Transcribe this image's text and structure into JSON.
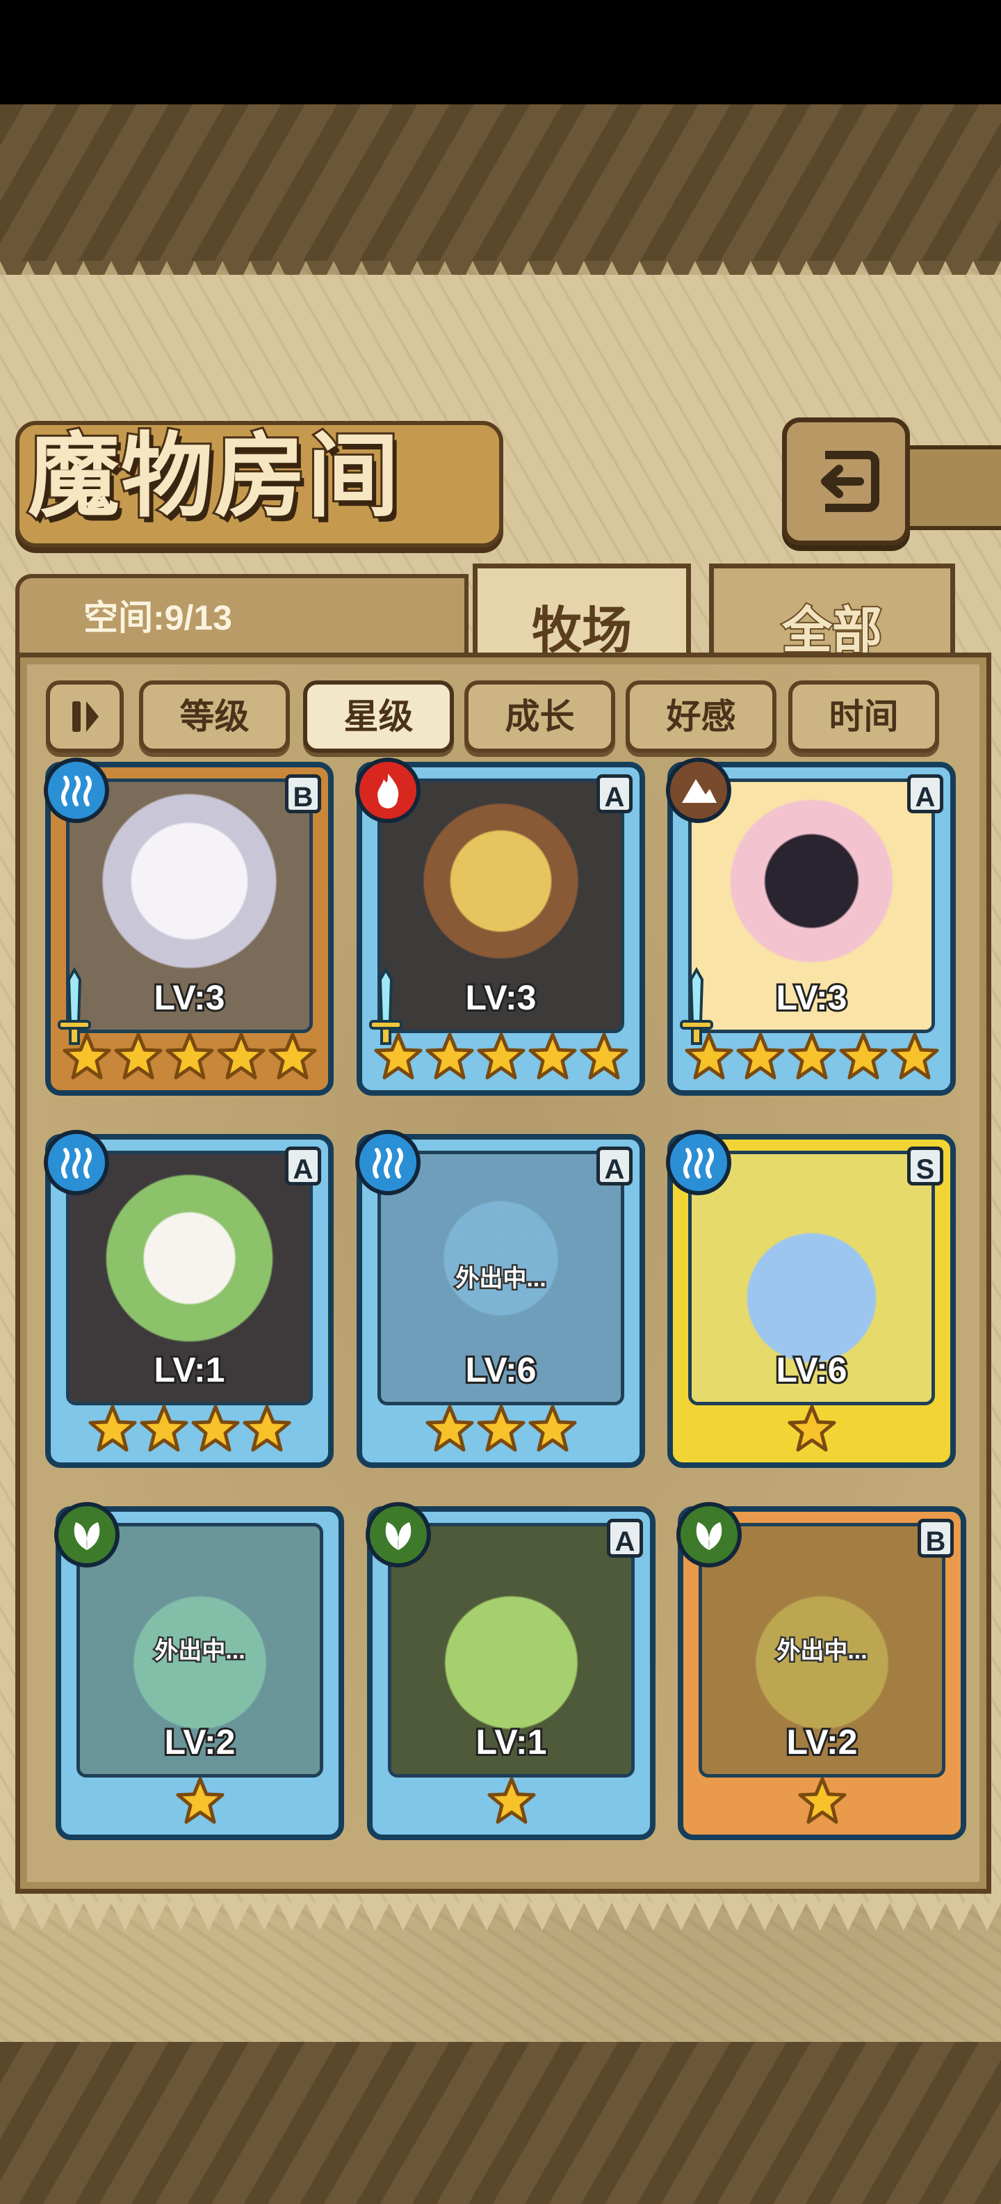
{
  "title": "魔物房间",
  "space": {
    "label": "空间:",
    "value": "9/13"
  },
  "tabs": [
    {
      "label": "牧场",
      "active": true
    },
    {
      "label": "全部",
      "active": false
    }
  ],
  "sort": {
    "icon": "pause-sort-icon",
    "buttons": [
      {
        "label": "等级",
        "active": false
      },
      {
        "label": "星级",
        "active": true
      },
      {
        "label": "成长",
        "active": false
      },
      {
        "label": "好感",
        "active": false
      },
      {
        "label": "时间",
        "active": false
      }
    ]
  },
  "cards": [
    {
      "element": "water",
      "rank": "B",
      "level": "LV:3",
      "stars": 5,
      "status": "",
      "frame": "bronze",
      "weapon": true
    },
    {
      "element": "fire",
      "rank": "A",
      "level": "LV:3",
      "stars": 5,
      "status": "",
      "frame": "blue",
      "weapon": true
    },
    {
      "element": "earth",
      "rank": "A",
      "level": "LV:3",
      "stars": 5,
      "status": "",
      "frame": "blue",
      "weapon": true
    },
    {
      "element": "water",
      "rank": "A",
      "level": "LV:1",
      "stars": 4,
      "status": "",
      "frame": "blue",
      "weapon": false
    },
    {
      "element": "water",
      "rank": "A",
      "level": "LV:6",
      "stars": 3,
      "status": "外出中...",
      "frame": "blue",
      "weapon": false
    },
    {
      "element": "water",
      "rank": "S",
      "level": "LV:6",
      "stars": 1,
      "status": "",
      "frame": "gold",
      "weapon": false
    },
    {
      "element": "grass",
      "rank": "",
      "level": "LV:2",
      "stars": 1,
      "status": "外出中...",
      "frame": "blue",
      "weapon": false
    },
    {
      "element": "grass",
      "rank": "A",
      "level": "LV:1",
      "stars": 1,
      "status": "",
      "frame": "blue",
      "weapon": false
    },
    {
      "element": "grass",
      "rank": "B",
      "level": "LV:2",
      "stars": 1,
      "status": "外出中...",
      "frame": "orange",
      "weapon": false
    }
  ],
  "colors": {
    "water": "#2b8fd6",
    "fire": "#d8271f",
    "earth": "#7a4a2c",
    "grass": "#3d7a2a",
    "frame_blue": "#7fc6e8",
    "frame_bronze": "#c8873a",
    "frame_gold": "#f2d534",
    "frame_orange": "#e99a4a"
  }
}
